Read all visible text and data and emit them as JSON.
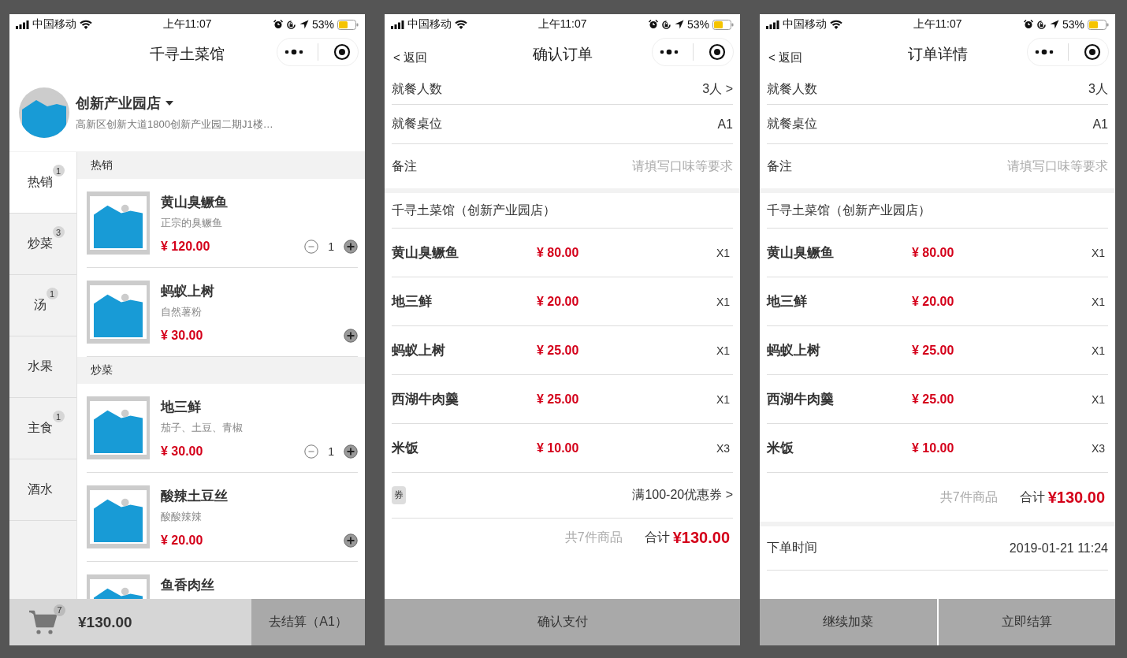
{
  "screens": [
    {
      "kind": "menu",
      "status_bar": {
        "carrier": "中国移动",
        "time": "上午11:07",
        "battery": "53%"
      },
      "title": "千寻土菜馆",
      "store": {
        "name": "创新产业园店",
        "address": "高新区创新大道1800创新产业园二期J1楼…"
      },
      "categories": [
        {
          "label": "热销",
          "badge": "1",
          "selected": true
        },
        {
          "label": "炒菜",
          "badge": "3",
          "selected": false
        },
        {
          "label": "汤",
          "badge": "1",
          "selected": false
        },
        {
          "label": "水果",
          "selected": false
        },
        {
          "label": "主食",
          "badge": "1",
          "selected": false
        },
        {
          "label": "酒水",
          "selected": false
        }
      ],
      "sections": [
        {
          "title": "热销",
          "dishes": [
            {
              "name": "黄山臭鳜鱼",
              "description": "正宗的臭鳜鱼",
              "price": "¥ 120.00",
              "quantity": "1"
            },
            {
              "name": "蚂蚁上树",
              "description": "自然薯粉",
              "price": "¥ 30.00"
            }
          ]
        },
        {
          "title": "炒菜",
          "dishes": [
            {
              "name": "地三鲜",
              "description": "茄子、土豆、青椒",
              "price": "¥ 30.00",
              "quantity": "1"
            },
            {
              "name": "酸辣土豆丝",
              "description": "酸酸辣辣",
              "price": "¥ 20.00"
            },
            {
              "name": "鱼香肉丝"
            }
          ]
        }
      ],
      "cart": {
        "count": "7",
        "total": "¥130.00"
      },
      "buttons": [
        "去结算（A1）"
      ]
    },
    {
      "kind": "order",
      "status_bar": {
        "carrier": "中国移动",
        "time": "上午11:07",
        "battery": "53%"
      },
      "back": "< 返回",
      "title": "确认订单",
      "fields": [
        {
          "label": "就餐人数",
          "value": "3人 >"
        },
        {
          "label": "就餐桌位",
          "value": "A1"
        },
        {
          "label": "备注",
          "placeholder": "请填写口味等要求"
        }
      ],
      "restaurant": "千寻土菜馆（创新产业园店）",
      "items": [
        {
          "name": "黄山臭鳜鱼",
          "price": "¥ 80.00",
          "quantity": "X1"
        },
        {
          "name": "地三鲜",
          "price": "¥ 20.00",
          "quantity": "X1"
        },
        {
          "name": "蚂蚁上树",
          "price": "¥ 25.00",
          "quantity": "X1"
        },
        {
          "name": "西湖牛肉羹",
          "price": "¥ 25.00",
          "quantity": "X1"
        },
        {
          "name": "米饭",
          "price": "¥ 10.00",
          "quantity": "X3"
        }
      ],
      "coupon": {
        "tag": "券",
        "text": "满100-20优惠券 >"
      },
      "summary": {
        "count": "共7件商品",
        "total_label": "合计",
        "total": "¥130.00"
      },
      "buttons": [
        "确认支付"
      ]
    },
    {
      "kind": "order",
      "status_bar": {
        "carrier": "中国移动",
        "time": "上午11:07",
        "battery": "53%"
      },
      "back": "< 返回",
      "title": "订单详情",
      "fields": [
        {
          "label": "就餐人数",
          "value": "3人"
        },
        {
          "label": "就餐桌位",
          "value": "A1"
        },
        {
          "label": "备注",
          "placeholder": "请填写口味等要求"
        }
      ],
      "restaurant": "千寻土菜馆（创新产业园店）",
      "items": [
        {
          "name": "黄山臭鳜鱼",
          "price": "¥ 80.00",
          "quantity": "X1"
        },
        {
          "name": "地三鲜",
          "price": "¥ 20.00",
          "quantity": "X1"
        },
        {
          "name": "蚂蚁上树",
          "price": "¥ 25.00",
          "quantity": "X1"
        },
        {
          "name": "西湖牛肉羹",
          "price": "¥ 25.00",
          "quantity": "X1"
        },
        {
          "name": "米饭",
          "price": "¥ 10.00",
          "quantity": "X3"
        }
      ],
      "summary": {
        "count": "共7件商品",
        "total_label": "合计",
        "total": "¥130.00"
      },
      "info": [
        {
          "label": "下单时间",
          "value": "2019-01-21 11:24"
        }
      ],
      "buttons": [
        "继续加菜",
        "立即结算"
      ]
    }
  ]
}
